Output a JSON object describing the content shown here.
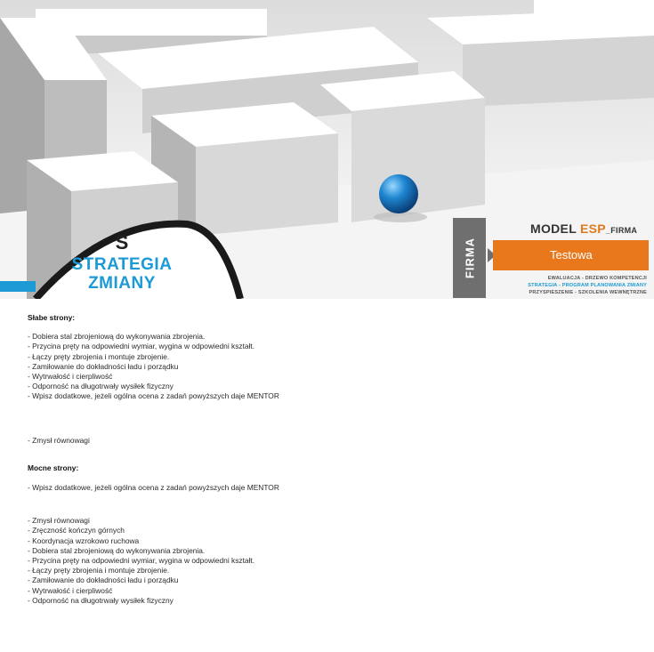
{
  "hero": {
    "badge_letter": "S",
    "badge_line1": "STRATEGIA",
    "badge_line2": "ZMIANY"
  },
  "model": {
    "side_tab": "FIRMA",
    "title_main": "MODEL ",
    "title_esp": "ESP",
    "title_suffix": "_FIRMA",
    "company_name": "Testowa",
    "subline1": "EWALUACJA - DRZEWO KOMPETENCJI",
    "subline2": "STRATEGIA - PROGRAM PLANOWANIA ZMIANY",
    "subline3": "PRZYSPIESZENIE - SZKOLENIA WEWNĘTRZNE",
    "accent_orange": "#e9781d",
    "accent_blue": "#1b9ad6"
  },
  "weak": {
    "heading": "Słabe strony:",
    "items": [
      "- Dobiera stal zbrojeniową do wykonywania zbrojenia.",
      "- Przycina pręty na odpowiedni wymiar, wygina w odpowiedni kształt.",
      "- Łączy pręty zbrojenia i montuje zbrojenie.",
      "- Zamiłowanie do dokładności ładu i porządku",
      "- Wytrwałość i cierpliwość",
      "- Odporność na długotrwały wysiłek fizyczny",
      "- Wpisz dodatkowe, jeżeli ogólna ocena z zadań powyższych daje MENTOR"
    ],
    "extra": "- Zmysł równowagi"
  },
  "strong": {
    "heading": "Mocne strony:",
    "intro": "- Wpisz dodatkowe, jeżeli ogólna ocena z zadań powyższych daje MENTOR",
    "items": [
      "- Zmysł równowagi",
      "- Zręczność kończyn górnych",
      "- Koordynacja wzrokowo ruchowa",
      "- Dobiera stal zbrojeniową do wykonywania zbrojenia.",
      "- Przycina pręty na odpowiedni wymiar, wygina w odpowiedni kształt.",
      "- Łączy pręty zbrojenia i montuje zbrojenie.",
      "- Zamiłowanie do dokładności ładu i porządku",
      "- Wytrwałość i cierpliwość",
      "- Odporność na długotrwały wysiłek fizyczny"
    ]
  }
}
